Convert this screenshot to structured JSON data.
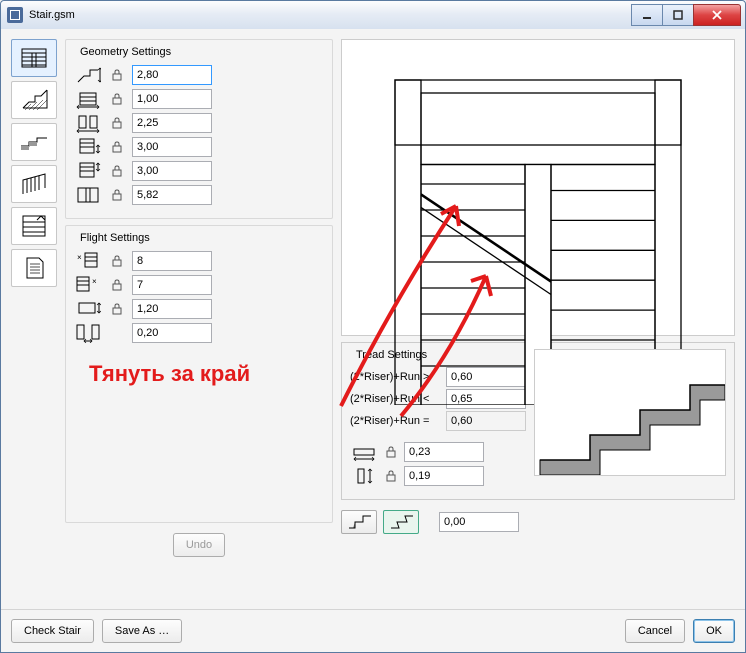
{
  "window": {
    "title": "Stair.gsm"
  },
  "nav": {
    "items": [
      {
        "name": "mode-2d",
        "selected": true
      },
      {
        "name": "mode-section",
        "selected": false
      },
      {
        "name": "mode-side",
        "selected": false
      },
      {
        "name": "mode-railing",
        "selected": false
      },
      {
        "name": "mode-list",
        "selected": false
      },
      {
        "name": "mode-doc",
        "selected": false
      }
    ]
  },
  "geometry": {
    "title": "Geometry Settings",
    "rows": [
      {
        "val": "2,80",
        "active": true
      },
      {
        "val": "1,00"
      },
      {
        "val": "2,25"
      },
      {
        "val": "3,00"
      },
      {
        "val": "3,00"
      },
      {
        "val": "5,82"
      }
    ]
  },
  "flight": {
    "title": "Flight Settings",
    "rows": [
      {
        "val": "8"
      },
      {
        "val": "7"
      },
      {
        "val": "1,20"
      },
      {
        "val": "0,20",
        "nolock": true
      }
    ]
  },
  "tread": {
    "title": "Tread Settings",
    "formula": [
      {
        "label": "(2*Riser)+Run >",
        "val": "0,60"
      },
      {
        "label": "(2*Riser)+Run <",
        "val": "0,65"
      },
      {
        "label": "(2*Riser)+Run =",
        "val": "0,60",
        "ro": true
      }
    ],
    "dims": [
      {
        "val": "0,23"
      },
      {
        "val": "0,19"
      }
    ],
    "nosing": {
      "val": "0,00"
    }
  },
  "buttons": {
    "undo": "Undo",
    "check": "Check Stair",
    "saveas": "Save As …",
    "cancel": "Cancel",
    "ok": "OK"
  },
  "annotation": "Тянуть за край"
}
